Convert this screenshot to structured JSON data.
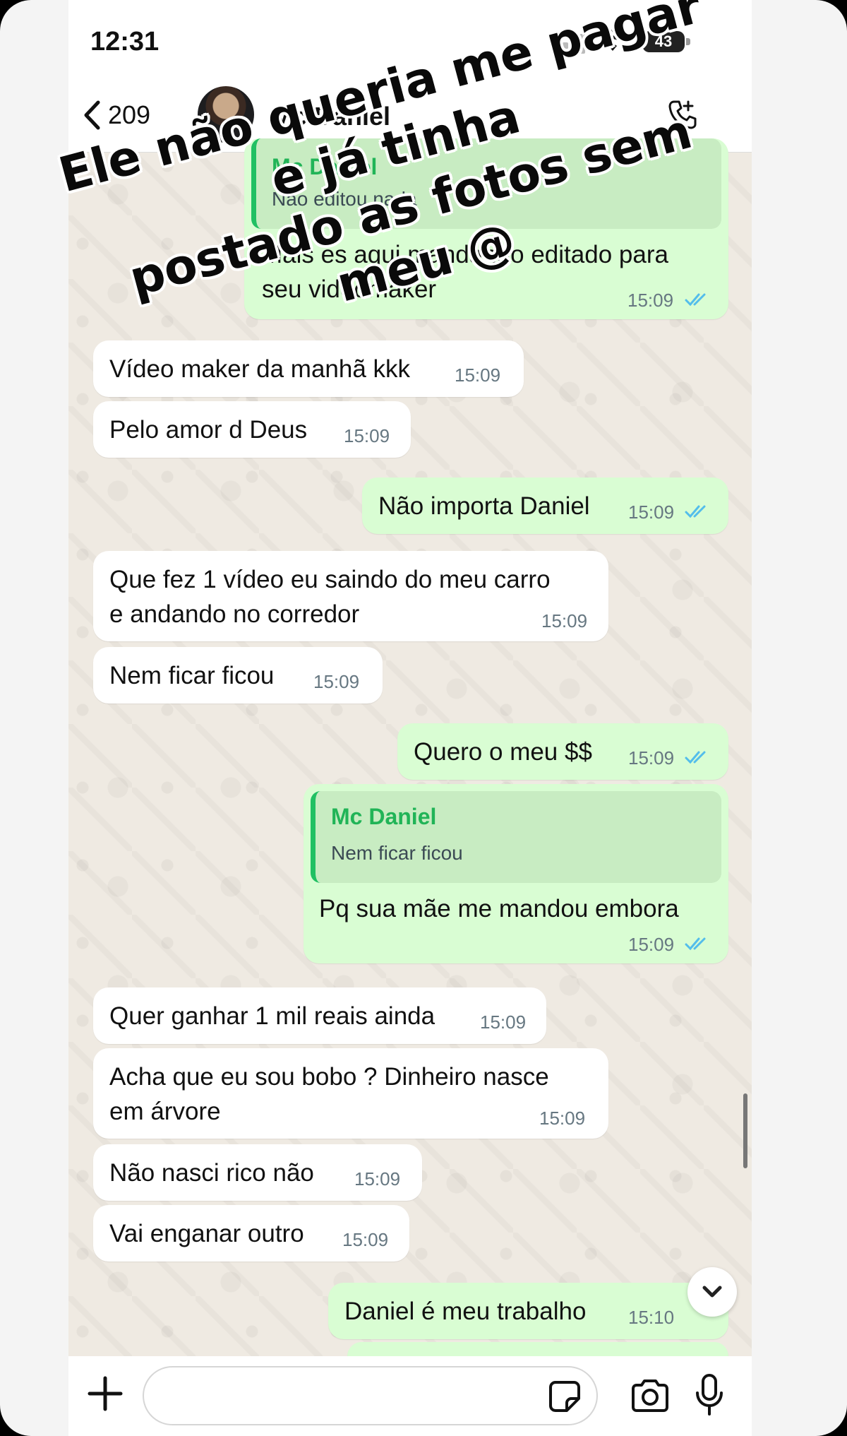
{
  "status_bar": {
    "time": "12:31",
    "battery": "43"
  },
  "header": {
    "back_count": "209",
    "contact_name": "Mc Daniel"
  },
  "caption": {
    "line1": "Ele não queria me pagar e já tinha",
    "line2": "postado as fotos sem meu @"
  },
  "messages": [
    {
      "dir": "out",
      "quote_name": "Mc Daniel",
      "quote_text": "Não editou nada",
      "text_lines": [
        "Mais es aqui mandando editado para",
        "seu videomaker"
      ],
      "time": "15:09"
    },
    {
      "dir": "in",
      "text": "Vídeo maker da manhã kkk",
      "time": "15:09"
    },
    {
      "dir": "in",
      "text": "Pelo amor d Deus",
      "time": "15:09"
    },
    {
      "dir": "out",
      "text": "Não importa Daniel",
      "time": "15:09"
    },
    {
      "dir": "in",
      "text_lines": [
        "Que fez 1 vídeo eu saindo do meu carro",
        "e andando no corredor"
      ],
      "time": "15:09"
    },
    {
      "dir": "in",
      "text": "Nem ficar ficou",
      "time": "15:09"
    },
    {
      "dir": "out",
      "text": "Quero o meu $$",
      "time": "15:09"
    },
    {
      "dir": "out",
      "quote_name": "Mc Daniel",
      "quote_text": "Nem ficar ficou",
      "text": "Pq sua mãe me mandou embora",
      "time": "15:09"
    },
    {
      "dir": "in",
      "text": "Quer ganhar 1 mil reais ainda",
      "time": "15:09"
    },
    {
      "dir": "in",
      "text_lines": [
        "Acha que eu sou bobo ? Dinheiro nasce",
        "em árvore"
      ],
      "time": "15:09"
    },
    {
      "dir": "in",
      "text": "Não nasci rico não",
      "time": "15:09"
    },
    {
      "dir": "in",
      "text": "Vai enganar outro",
      "time": "15:09"
    },
    {
      "dir": "out",
      "text": "Daniel é meu trabalho",
      "time": "15:10"
    }
  ],
  "input": {
    "placeholder": ""
  },
  "colors": {
    "outgoing": "#d9fdd3",
    "incoming": "#ffffff",
    "tick_blue": "#53bdeb",
    "quote_green": "#21c063"
  },
  "icons": [
    "back-icon",
    "call-icon",
    "double-check-icon",
    "chevron-down-icon",
    "plus-icon",
    "sticker-icon",
    "camera-icon",
    "mic-icon"
  ]
}
